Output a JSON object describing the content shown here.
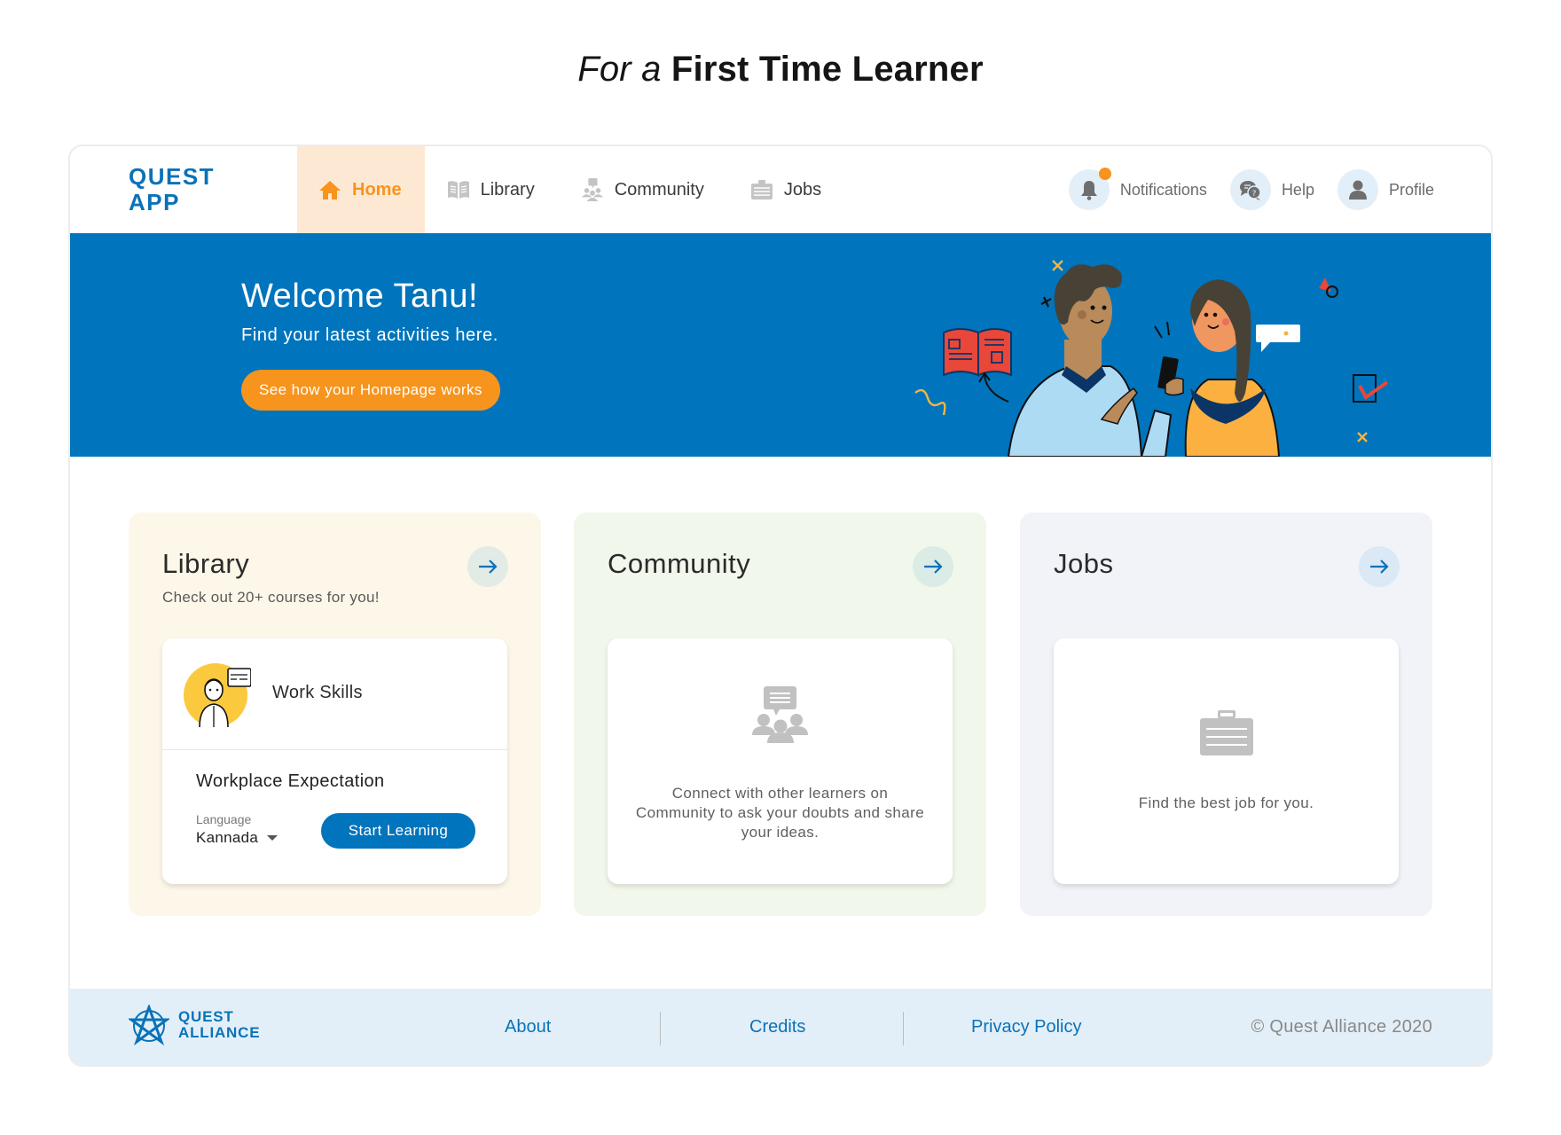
{
  "page_title": {
    "prefix": "For a",
    "emphasis": "First Time Learner"
  },
  "app": {
    "logo_line1": "QUEST",
    "logo_line2": "APP",
    "nav": [
      {
        "label": "Home",
        "icon": "home-icon",
        "active": true
      },
      {
        "label": "Library",
        "icon": "book-icon",
        "active": false
      },
      {
        "label": "Community",
        "icon": "community-icon",
        "active": false
      },
      {
        "label": "Jobs",
        "icon": "briefcase-icon",
        "active": false
      }
    ],
    "right_nav": [
      {
        "label": "Notifications",
        "icon": "bell-icon",
        "has_badge": true
      },
      {
        "label": "Help",
        "icon": "chat-help-icon"
      },
      {
        "label": "Profile",
        "icon": "user-icon"
      }
    ]
  },
  "banner": {
    "title": "Welcome Tanu!",
    "subtitle": "Find your latest activities here.",
    "button_label": "See how your Homepage works"
  },
  "cards": {
    "library": {
      "title": "Library",
      "subtitle": "Check out 20+ courses for you!",
      "course": {
        "category": "Work Skills",
        "name": "Workplace Expectation",
        "language_label": "Language",
        "language_value": "Kannada",
        "button_label": "Start Learning"
      }
    },
    "community": {
      "title": "Community",
      "empty_text": "Connect with other learners on Community to ask your doubts and share your ideas."
    },
    "jobs": {
      "title": "Jobs",
      "empty_text": "Find the best job for you."
    }
  },
  "footer": {
    "logo_line1": "QUEST",
    "logo_line2": "ALLIANCE",
    "links": [
      "About",
      "Credits",
      "Privacy Policy"
    ],
    "copyright": "© Quest Alliance 2020"
  },
  "colors": {
    "brand_blue": "#0074BC",
    "accent_orange": "#F7941D",
    "active_tab_bg": "#FDE9D3",
    "library_card_bg": "#FDF7E9",
    "community_card_bg": "#F1F7EA",
    "jobs_card_bg": "#F1F3F8",
    "footer_bg": "#E3EFF8"
  }
}
